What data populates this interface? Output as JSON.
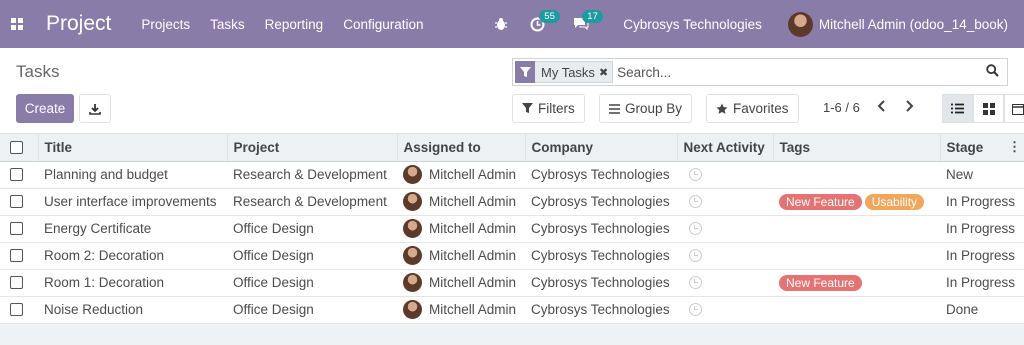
{
  "navbar": {
    "brand": "Project",
    "menu": [
      "Projects",
      "Tasks",
      "Reporting",
      "Configuration"
    ],
    "activity_count": "55",
    "message_count": "17",
    "company": "Cybrosys Technologies",
    "user": "Mitchell Admin (odoo_14_book)"
  },
  "control_panel": {
    "title": "Tasks",
    "create_label": "Create",
    "facet_label": "My Tasks",
    "search_placeholder": "Search...",
    "filters_label": "Filters",
    "group_by_label": "Group By",
    "favorites_label": "Favorites",
    "pager": "1-6 / 6"
  },
  "table": {
    "columns": [
      "Title",
      "Project",
      "Assigned to",
      "Company",
      "Next Activity",
      "Tags",
      "Stage"
    ],
    "rows": [
      {
        "title": "Planning and budget",
        "project": "Research & Development",
        "assignee": "Mitchell Admin",
        "company": "Cybrosys Technologies",
        "tags": [],
        "stage": "New"
      },
      {
        "title": "User interface improvements",
        "project": "Research & Development",
        "assignee": "Mitchell Admin",
        "company": "Cybrosys Technologies",
        "tags": [
          {
            "label": "New Feature",
            "color": "#e57373"
          },
          {
            "label": "Usability",
            "color": "#f0a65b"
          }
        ],
        "stage": "In Progress"
      },
      {
        "title": "Energy Certificate",
        "project": "Office Design",
        "assignee": "Mitchell Admin",
        "company": "Cybrosys Technologies",
        "tags": [],
        "stage": "In Progress"
      },
      {
        "title": "Room 2: Decoration",
        "project": "Office Design",
        "assignee": "Mitchell Admin",
        "company": "Cybrosys Technologies",
        "tags": [],
        "stage": "In Progress"
      },
      {
        "title": "Room 1: Decoration",
        "project": "Office Design",
        "assignee": "Mitchell Admin",
        "company": "Cybrosys Technologies",
        "tags": [
          {
            "label": "New Feature",
            "color": "#e57373"
          }
        ],
        "stage": "In Progress"
      },
      {
        "title": "Noise Reduction",
        "project": "Office Design",
        "assignee": "Mitchell Admin",
        "company": "Cybrosys Technologies",
        "tags": [],
        "stage": "Done"
      }
    ]
  },
  "colors": {
    "brand": "#8a7ca8",
    "badge": "#1b9ca0"
  }
}
